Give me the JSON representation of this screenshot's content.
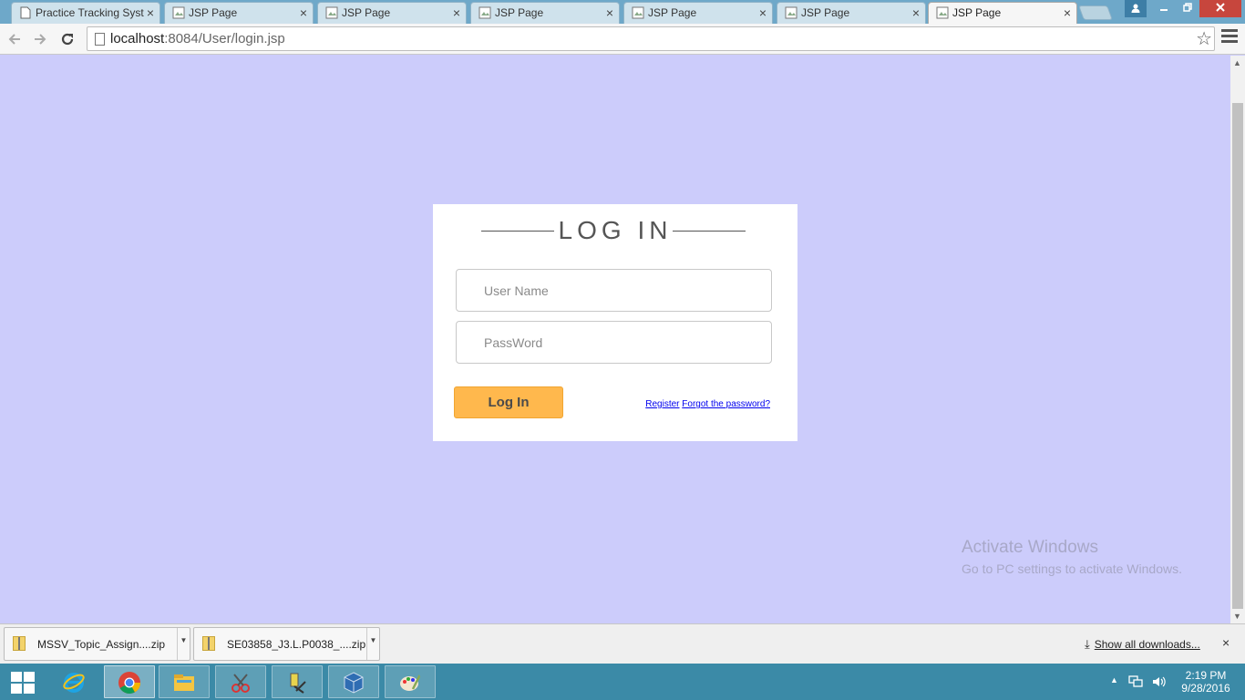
{
  "tabs": [
    {
      "title": "Practice Tracking Syst",
      "active": false
    },
    {
      "title": "JSP Page",
      "active": false
    },
    {
      "title": "JSP Page",
      "active": false
    },
    {
      "title": "JSP Page",
      "active": false
    },
    {
      "title": "JSP Page",
      "active": false
    },
    {
      "title": "JSP Page",
      "active": false
    },
    {
      "title": "JSP Page",
      "active": true
    }
  ],
  "tab_close_glyph": "×",
  "address_bar": {
    "host": "localhost",
    "rest": ":8084/User/login.jsp"
  },
  "login": {
    "title": "LOG IN",
    "username_placeholder": "User Name",
    "password_placeholder": "PassWord",
    "login_button": "Log In",
    "register_link": "Register",
    "forgot_link": "Forgot the password?"
  },
  "watermark": {
    "line1": "Activate Windows",
    "line2": "Go to PC settings to activate Windows."
  },
  "downloads": {
    "items": [
      {
        "name": "MSSV_Topic_Assign....zip"
      },
      {
        "name": "SE03858_J3.L.P0038_....zip"
      }
    ],
    "show_all": "Show all downloads...",
    "close_glyph": "×"
  },
  "taskbar": {
    "apps": [
      "internet-explorer",
      "chrome",
      "file-explorer",
      "snipping-tool",
      "remote-tool",
      "virtualbox",
      "paint"
    ],
    "time": "2:19 PM",
    "date": "9/28/2016"
  },
  "colors": {
    "page_background": "#ccccfb",
    "login_button": "#ffb84d",
    "taskbar": "#3b8aa7",
    "tabstrip": "#6ea8c9"
  }
}
